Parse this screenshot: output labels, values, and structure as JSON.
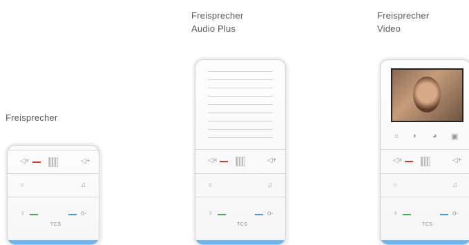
{
  "labels": {
    "audio_plus_line1": "Freisprecher",
    "audio_plus_line2": "Audio Plus",
    "video_line1": "Freisprecher",
    "video_line2": "Video",
    "basic": "Freisprecher"
  },
  "device": {
    "logo": "TCS",
    "icons": {
      "mute": "speaker-mute-icon",
      "volume_up": "speaker-plus-icon",
      "circle": "circle-icon",
      "bell": "bell-icon",
      "talk": "talk-icon",
      "key": "key-icon",
      "brightness": "brightness-icon",
      "contrast": "contrast-icon",
      "color": "color-icon",
      "camera": "camera-icon"
    },
    "colors": {
      "red": "#e0322c",
      "green": "#3ab54a",
      "blue": "#3a9ee0",
      "strip": "#6cb6ef"
    }
  }
}
